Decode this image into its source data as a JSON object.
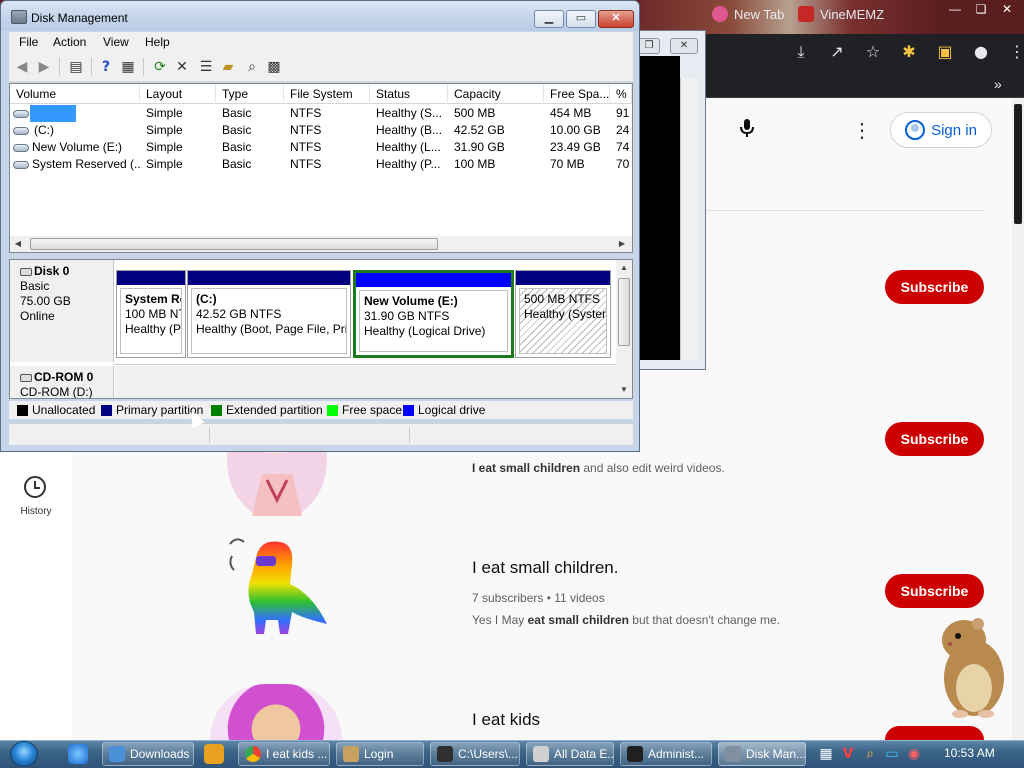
{
  "browser": {
    "window_buttons": [
      "—",
      "❏",
      "✕"
    ],
    "bookmarks": [
      {
        "label": "New Tab",
        "color": "#e0568f"
      },
      {
        "label": "VineMEMZ",
        "color": "#c62828"
      }
    ],
    "bookmarks_more": "»",
    "toolbar_icons": [
      "download-icon",
      "share-icon",
      "star-icon",
      "extensions-icon",
      "sidebar-icon",
      "profile-icon",
      "menu-icon"
    ]
  },
  "youtube": {
    "signin_label": "Sign in",
    "history_label": "History",
    "subscribe_label": "Subscribe",
    "channels": [
      {
        "desc_bold": "I eat small children",
        "desc_rest": " and also edit weird videos."
      },
      {
        "title": "I eat small children.",
        "meta": "7 subscribers • 11 videos",
        "desc_pre": "Yes I May ",
        "desc_bold": "eat small children",
        "desc_rest": " but that doesn't change me."
      },
      {
        "title": "I eat kids"
      }
    ]
  },
  "diskmgmt": {
    "title": "Disk Management",
    "menu": [
      "File",
      "Action",
      "View",
      "Help"
    ],
    "columns": [
      "Volume",
      "Layout",
      "Type",
      "File System",
      "Status",
      "Capacity",
      "Free Spa...",
      "% F"
    ],
    "rows": [
      {
        "volume": "",
        "layout": "Simple",
        "type": "Basic",
        "fs": "NTFS",
        "status": "Healthy (S...",
        "capacity": "500 MB",
        "free": "454 MB",
        "pct": "91",
        "selected": true
      },
      {
        "volume": "(C:)",
        "layout": "Simple",
        "type": "Basic",
        "fs": "NTFS",
        "status": "Healthy (B...",
        "capacity": "42.52 GB",
        "free": "10.00 GB",
        "pct": "24"
      },
      {
        "volume": "New Volume (E:)",
        "layout": "Simple",
        "type": "Basic",
        "fs": "NTFS",
        "status": "Healthy (L...",
        "capacity": "31.90 GB",
        "free": "23.49 GB",
        "pct": "74"
      },
      {
        "volume": "System Reserved (...",
        "layout": "Simple",
        "type": "Basic",
        "fs": "NTFS",
        "status": "Healthy (P...",
        "capacity": "100 MB",
        "free": "70 MB",
        "pct": "70"
      }
    ],
    "disk0": {
      "name": "Disk 0",
      "type": "Basic",
      "size": "75.00 GB",
      "state": "Online"
    },
    "partitions": [
      {
        "name": "System Re",
        "size": "100 MB NT",
        "status": "Healthy (P"
      },
      {
        "name": "(C:)",
        "size": "42.52 GB NTFS",
        "status": "Healthy (Boot, Page File, Prir"
      },
      {
        "name": "New Volume  (E:)",
        "size": "31.90 GB NTFS",
        "status": "Healthy (Logical Drive)"
      },
      {
        "name": "",
        "size": "500 MB NTFS",
        "status": "Healthy (System"
      }
    ],
    "cdrom": {
      "name": "CD-ROM 0",
      "drive": "CD-ROM (D:)"
    },
    "legend": [
      {
        "label": "Unallocated",
        "color": "#000000"
      },
      {
        "label": "Primary partition",
        "color": "#000080"
      },
      {
        "label": "Extended partition",
        "color": "#008000"
      },
      {
        "label": "Free space",
        "color": "#00ff00"
      },
      {
        "label": "Logical drive",
        "color": "#0000ff"
      }
    ]
  },
  "taskbar": {
    "tasks": [
      {
        "label": "Downloads",
        "color": "#4a90d9"
      },
      {
        "label": "I eat kids ...",
        "color": "#f4c20d"
      },
      {
        "label": "Login",
        "color": "#c8a060"
      },
      {
        "label": "C:\\Users\\...",
        "color": "#303030"
      },
      {
        "label": "All Data E...",
        "color": "#d0d0d0"
      },
      {
        "label": "Administ...",
        "color": "#202020"
      },
      {
        "label": "Disk Man...",
        "color": "#8090a0"
      }
    ],
    "clock": "10:53 AM"
  }
}
